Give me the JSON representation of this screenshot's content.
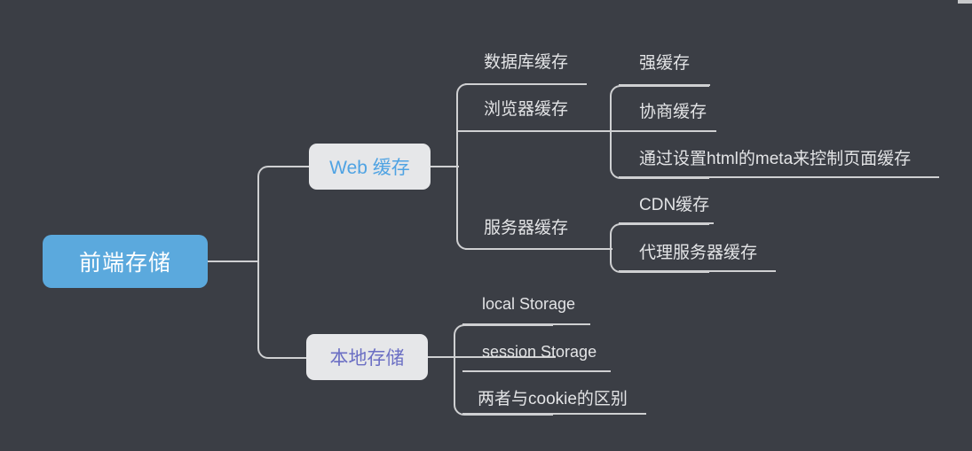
{
  "theme": {
    "background": "#3b3e45",
    "line_color": "#cfd0d2",
    "text_color": "#e3e4e6",
    "root_fill": "#5ba9dd",
    "root_text": "#ffffff",
    "branch_fill": "#e6e7e9",
    "web_text": "#4fa3e3",
    "local_text": "#6b6fc4"
  },
  "mindmap": {
    "root": {
      "label": "前端存储"
    },
    "branches": [
      {
        "label": "Web 缓存",
        "children": [
          {
            "label": "数据库缓存",
            "children": []
          },
          {
            "label": "浏览器缓存",
            "children": [
              {
                "label": "强缓存"
              },
              {
                "label": "协商缓存"
              },
              {
                "label": "通过设置html的meta来控制页面缓存"
              }
            ]
          },
          {
            "label": "服务器缓存",
            "children": [
              {
                "label": "CDN缓存"
              },
              {
                "label": "代理服务器缓存"
              }
            ]
          }
        ]
      },
      {
        "label": "本地存储",
        "children": [
          {
            "label": "local Storage",
            "children": []
          },
          {
            "label": "session Storage",
            "children": []
          },
          {
            "label": "两者与cookie的区别",
            "children": []
          }
        ]
      }
    ]
  }
}
